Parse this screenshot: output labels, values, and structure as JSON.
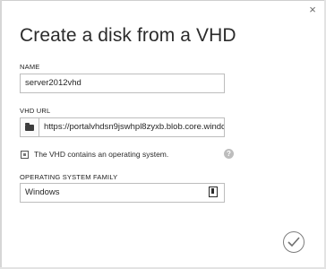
{
  "dialog": {
    "title": "Create a disk from a VHD",
    "close_glyph": "×"
  },
  "name_field": {
    "label": "NAME",
    "value": "server2012vhd"
  },
  "vhd_url_field": {
    "label": "VHD URL",
    "browse_icon": "folder-icon",
    "value": "https://portalvhdsn9jswhpl8zyxb.blob.core.windc"
  },
  "os_checkbox": {
    "label": "The VHD contains an operating system.",
    "checked": true,
    "help_glyph": "?"
  },
  "os_family_field": {
    "label": "OPERATING SYSTEM FAMILY",
    "value": "Windows",
    "dropdown_icon": "select-icon"
  },
  "actions": {
    "confirm_icon": "checkmark-icon"
  }
}
